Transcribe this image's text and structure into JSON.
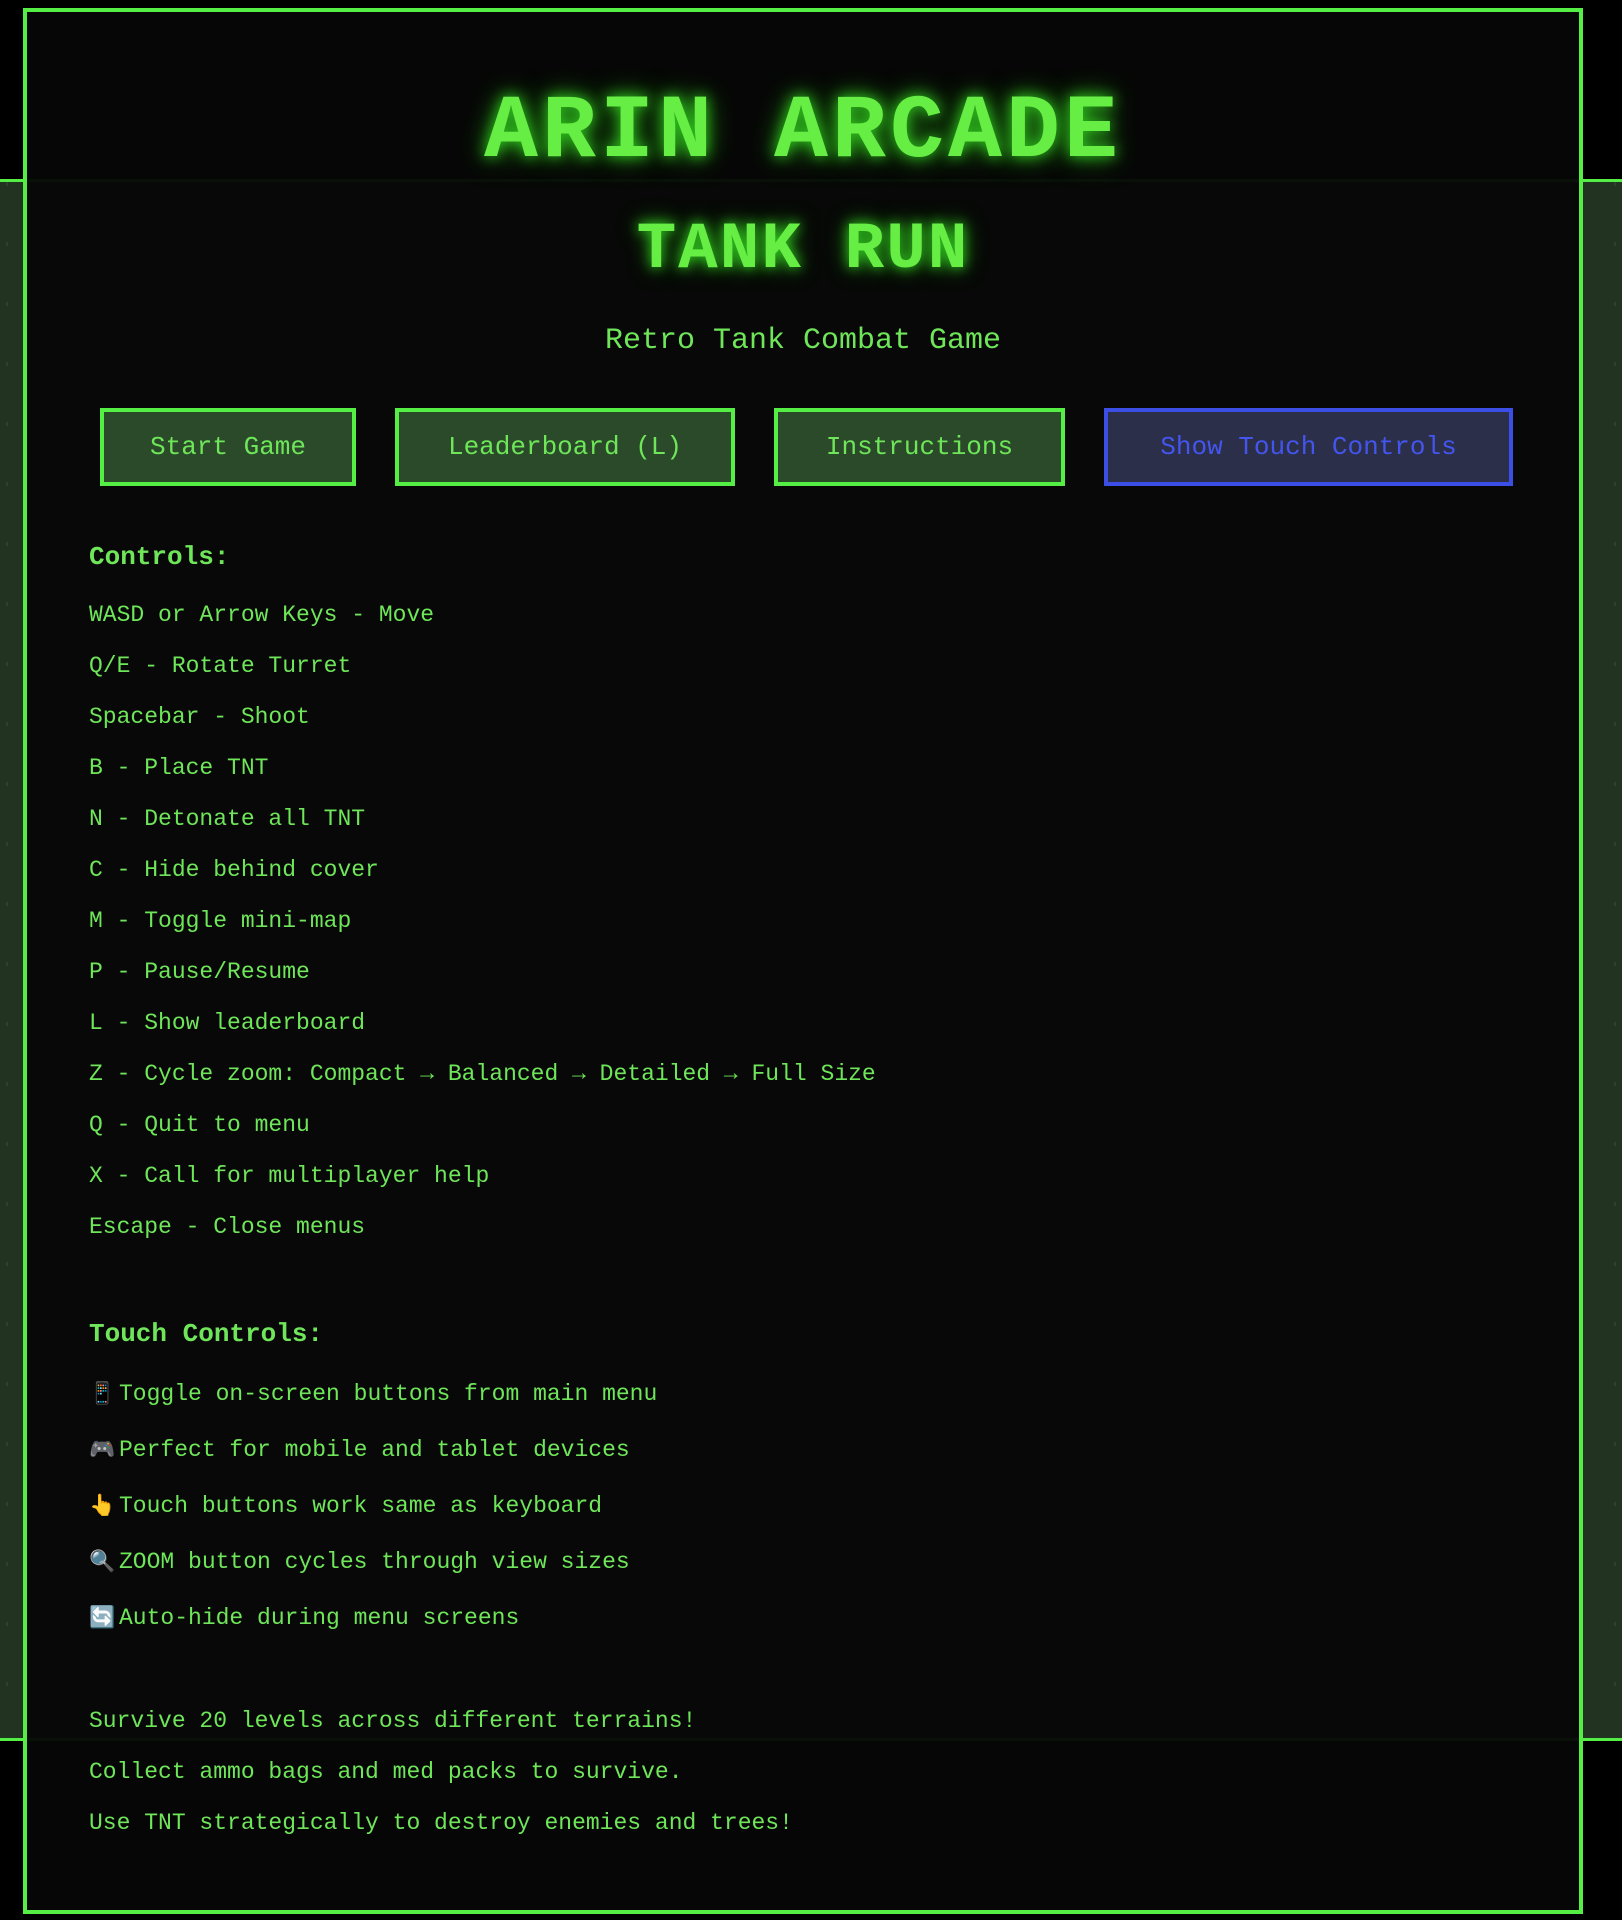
{
  "header": {
    "title": "ARIN ARCADE",
    "game_title": "TANK RUN",
    "tagline": "Retro Tank Combat Game"
  },
  "menu": {
    "start": "Start Game",
    "leaderboard": "Leaderboard (L)",
    "instructions": "Instructions",
    "touch": "Show Touch Controls"
  },
  "controls": {
    "heading": "Controls:",
    "items": [
      "WASD or Arrow Keys - Move",
      "Q/E - Rotate Turret",
      "Spacebar - Shoot",
      "B - Place TNT",
      "N - Detonate all TNT",
      "C - Hide behind cover",
      "M - Toggle mini-map",
      "P - Pause/Resume",
      "L - Show leaderboard",
      "Z - Cycle zoom: Compact → Balanced → Detailed → Full Size",
      "Q - Quit to menu",
      "X - Call for multiplayer help",
      "Escape - Close menus"
    ]
  },
  "touch_controls": {
    "heading": "Touch Controls:",
    "items": [
      {
        "icon": "📱",
        "icon_name": "mobile-phone-icon",
        "text": "Toggle on-screen buttons from main menu"
      },
      {
        "icon": "🎮",
        "icon_name": "gamepad-icon",
        "text": "Perfect for mobile and tablet devices"
      },
      {
        "icon": "👆",
        "icon_name": "pointing-finger-icon",
        "text": "Touch buttons work same as keyboard"
      },
      {
        "icon": "🔍",
        "icon_name": "magnifier-icon",
        "text": "ZOOM button cycles through view sizes"
      },
      {
        "icon": "🔄",
        "icon_name": "refresh-icon",
        "text": "Auto-hide during menu screens"
      }
    ]
  },
  "notes": [
    "Survive 20 levels across different terrains!",
    "Collect ammo bags and med packs to survive.",
    "Use TNT strategically to destroy enemies and trees!"
  ],
  "colors": {
    "accent_green": "#55ee44",
    "text_green": "#6fe65a",
    "touch_blue": "#3b4ee6",
    "background": "#000000"
  }
}
